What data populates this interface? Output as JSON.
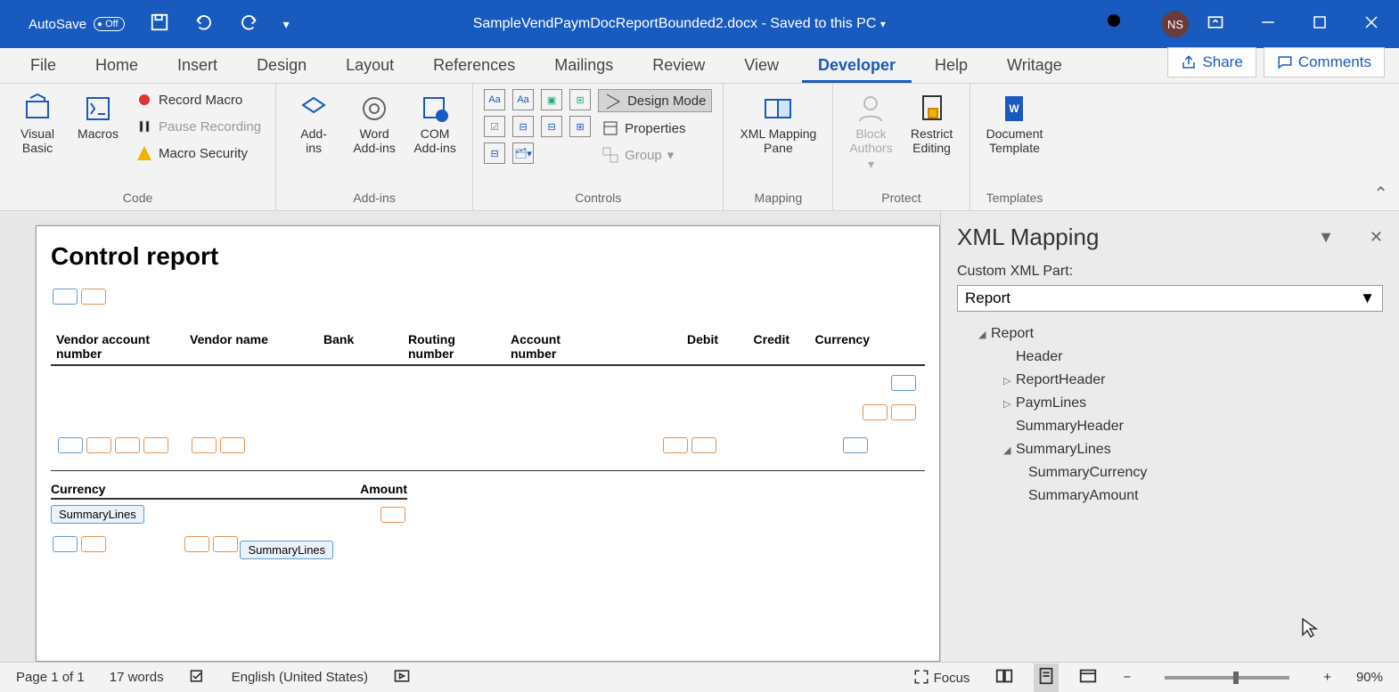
{
  "titlebar": {
    "autosave": "AutoSave",
    "autosave_state": "Off",
    "filename": "SampleVendPaymDocReportBounded2.docx - Saved to this PC",
    "user_initials": "NS"
  },
  "tabs": {
    "file": "File",
    "home": "Home",
    "insert": "Insert",
    "design": "Design",
    "layout": "Layout",
    "references": "References",
    "mailings": "Mailings",
    "review": "Review",
    "view": "View",
    "developer": "Developer",
    "help": "Help",
    "writage": "Writage",
    "share": "Share",
    "comments": "Comments"
  },
  "ribbon": {
    "visual_basic": "Visual\nBasic",
    "macros": "Macros",
    "record_macro": "Record Macro",
    "pause_recording": "Pause Recording",
    "macro_security": "Macro Security",
    "code_group": "Code",
    "addins": "Add-\nins",
    "word_addins": "Word\nAdd-ins",
    "com_addins": "COM\nAdd-ins",
    "addins_group": "Add-ins",
    "design_mode": "Design Mode",
    "properties": "Properties",
    "group": "Group",
    "controls_group": "Controls",
    "xml_mapping_pane": "XML Mapping\nPane",
    "mapping_group": "Mapping",
    "block_authors": "Block\nAuthors",
    "restrict_editing": "Restrict\nEditing",
    "protect_group": "Protect",
    "doc_template": "Document\nTemplate",
    "templates_group": "Templates"
  },
  "document": {
    "title": "Control report",
    "columns": {
      "vendor_acct": "Vendor account number",
      "vendor_name": "Vendor name",
      "bank": "Bank",
      "routing": "Routing number",
      "account": "Account number",
      "debit": "Debit",
      "credit": "Credit",
      "currency": "Currency"
    },
    "summary_cols": {
      "currency": "Currency",
      "amount": "Amount"
    },
    "cc_label": "SummaryLines"
  },
  "pane": {
    "title": "XML Mapping",
    "label": "Custom XML Part:",
    "selected": "Report",
    "tree": {
      "report": "Report",
      "header": "Header",
      "report_header": "ReportHeader",
      "paym_lines": "PaymLines",
      "summary_header": "SummaryHeader",
      "summary_lines": "SummaryLines",
      "summary_currency": "SummaryCurrency",
      "summary_amount": "SummaryAmount"
    }
  },
  "status": {
    "page": "Page 1 of 1",
    "words": "17 words",
    "language": "English (United States)",
    "focus": "Focus",
    "zoom": "90%"
  }
}
